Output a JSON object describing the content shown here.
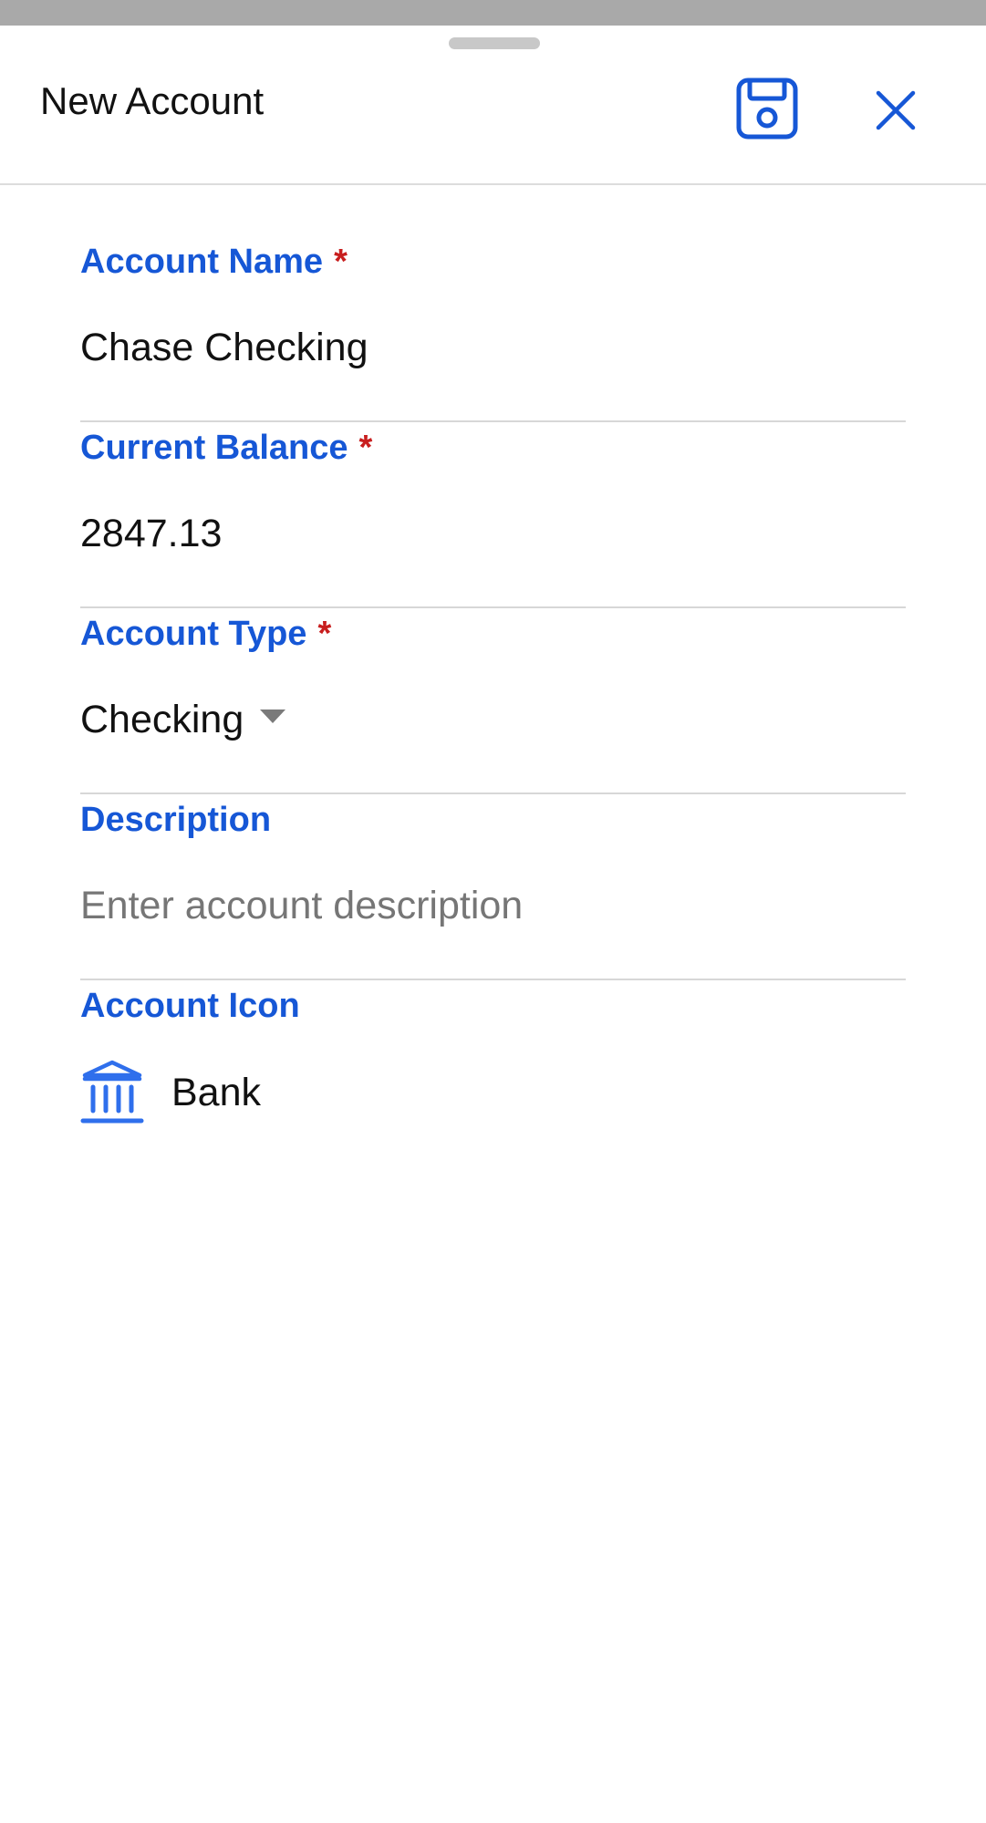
{
  "header": {
    "title": "New Account"
  },
  "form": {
    "account_name": {
      "label": "Account Name",
      "required_mark": "*",
      "value": "Chase Checking"
    },
    "current_balance": {
      "label": "Current Balance",
      "required_mark": "*",
      "value": "2847.13"
    },
    "account_type": {
      "label": "Account Type",
      "required_mark": "*",
      "value": "Checking"
    },
    "description": {
      "label": "Description",
      "placeholder": "Enter account description",
      "value": ""
    },
    "account_icon": {
      "label": "Account Icon",
      "icon": "bank-icon",
      "value": "Bank"
    }
  },
  "icons": {
    "save": "save-icon",
    "close": "close-icon",
    "dropdown": "chevron-down-icon"
  },
  "colors": {
    "accent": "#1657d6",
    "icon_blue": "#2f6fec",
    "required": "#c81e1e",
    "text": "#111111",
    "placeholder": "#767676",
    "divider": "#d7d7d7",
    "top_strip": "#a9a9a9"
  }
}
